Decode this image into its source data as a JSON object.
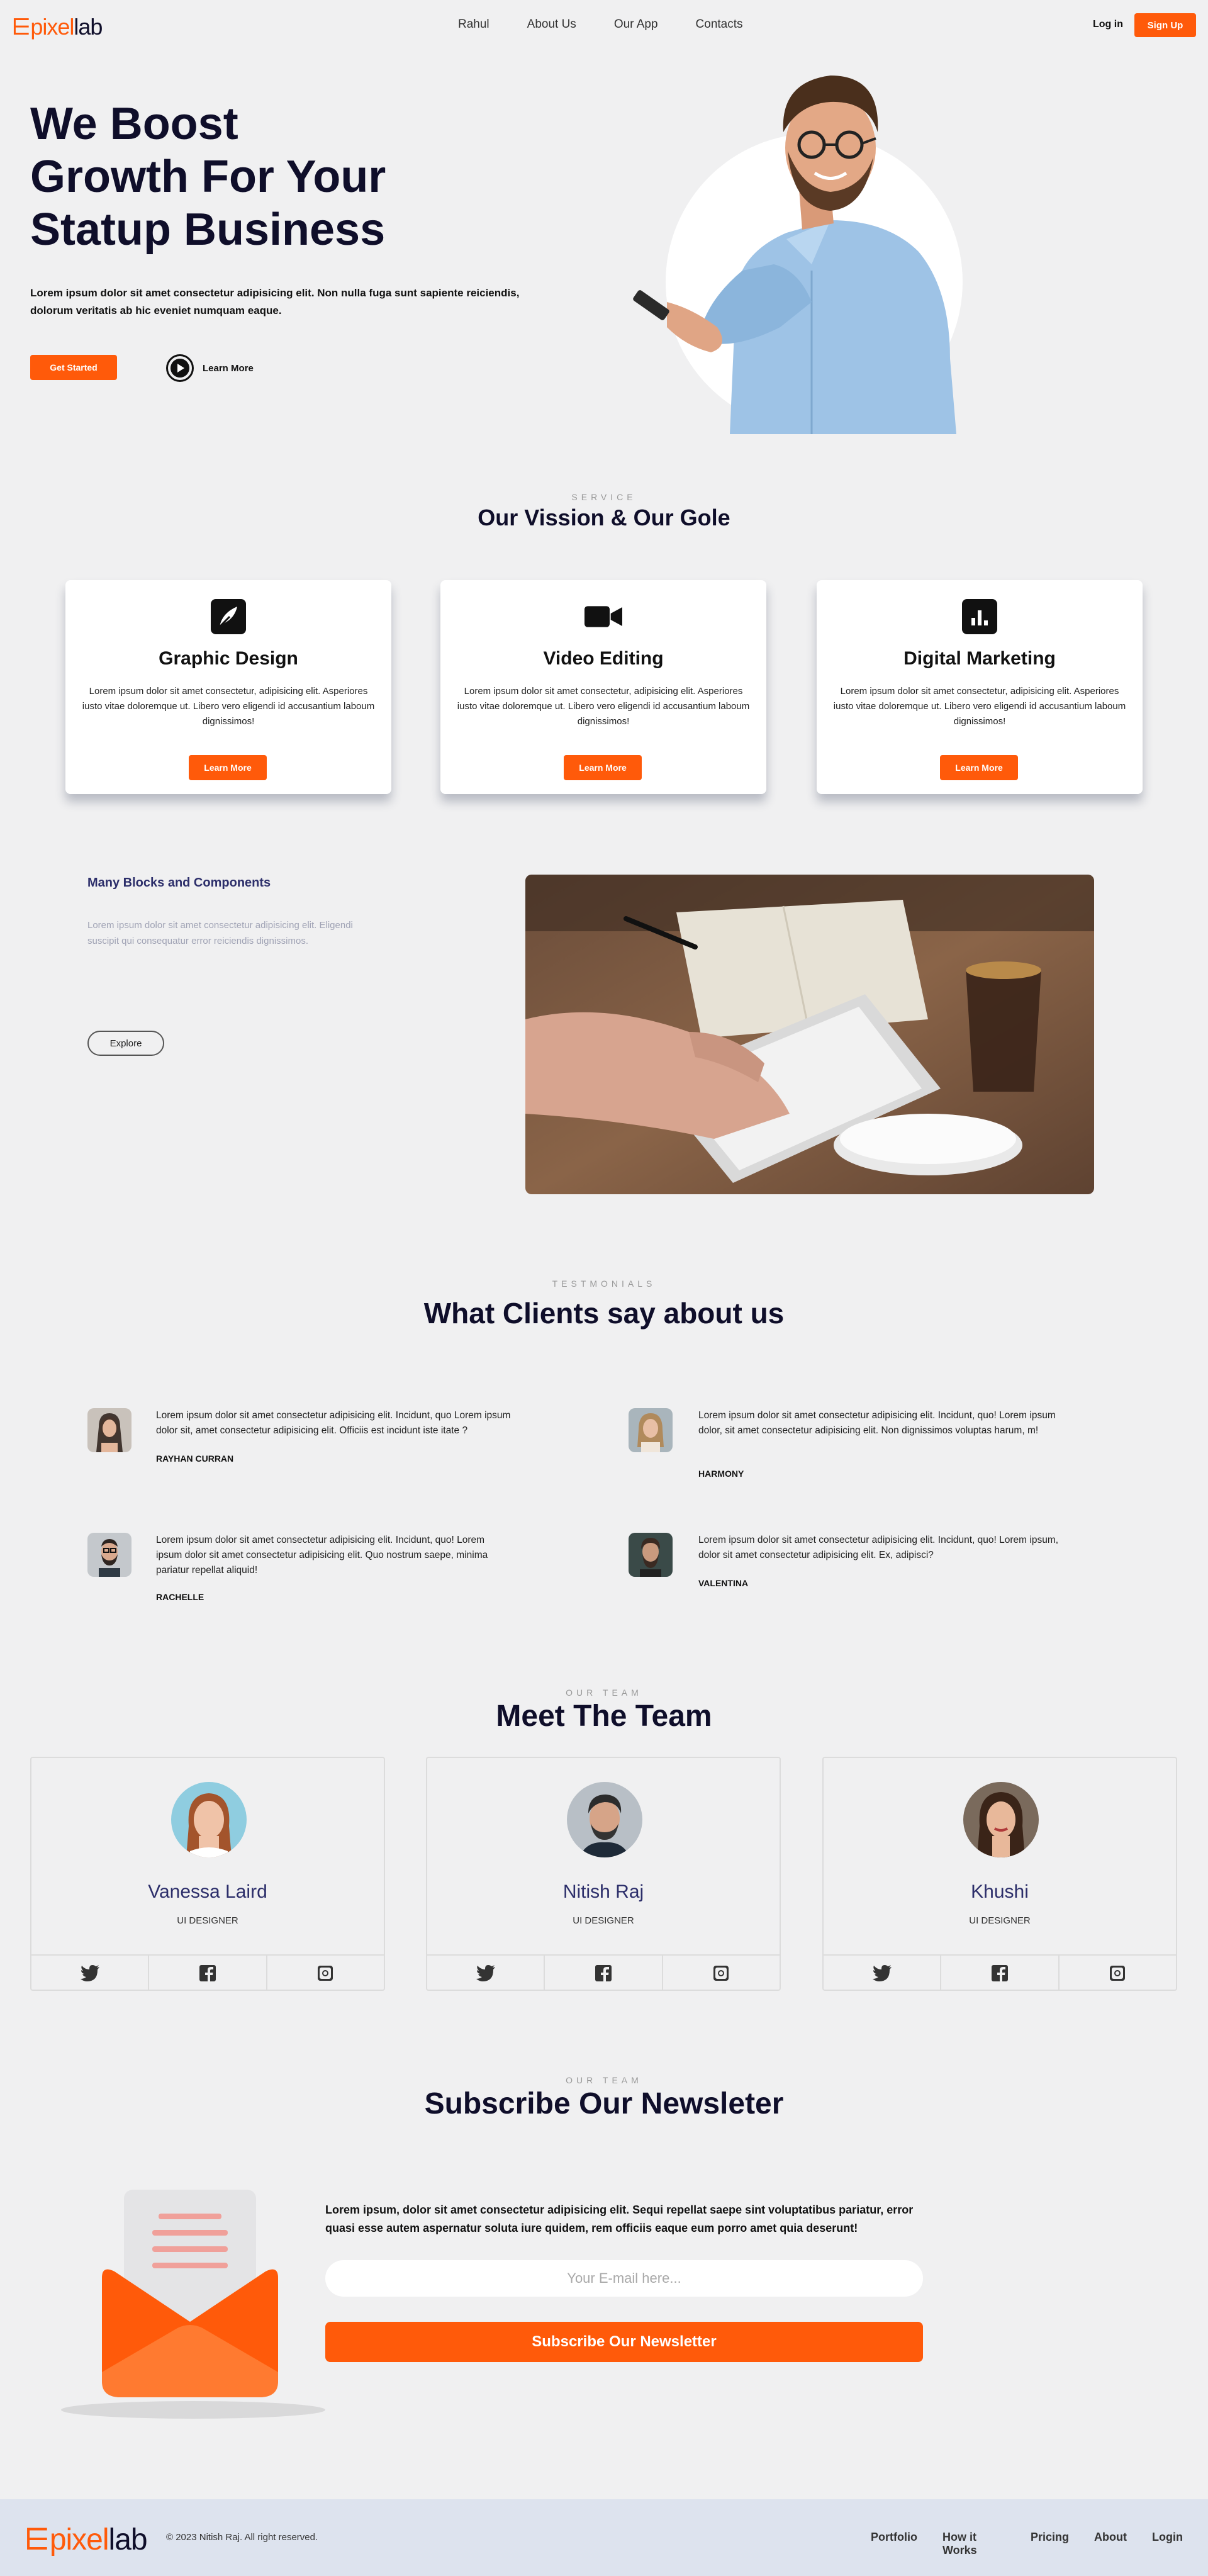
{
  "brand": {
    "logo_prefix": "⋿",
    "logo_pixel": "pixel",
    "logo_lab": "lab",
    "accent": "#ff5a0a",
    "navy": "#0f0e2a"
  },
  "nav": {
    "links": [
      "Rahul",
      "About Us",
      "Our App",
      "Contacts"
    ],
    "login": "Log in",
    "signup": "Sign Up"
  },
  "hero": {
    "title_lines": [
      "We Boost",
      "Growth For Your",
      "Statup Business"
    ],
    "description": "Lorem ipsum dolor sit amet consectetur adipisicing elit. Non nulla fuga sunt sapiente reiciendis, dolorum veritatis ab hic eveniet numquam eaque.",
    "cta_primary": "Get Started",
    "cta_secondary": "Learn More"
  },
  "service": {
    "kicker": "SERVICE",
    "title": "Our Vission & Our Gole",
    "cards": [
      {
        "icon": "feather-icon",
        "title": "Graphic Design",
        "text": "Lorem ipsum dolor sit amet consectetur, adipisicing elit. Asperiores iusto vitae doloremque ut. Libero vero eligendi id accusantium laboum dignissimos!",
        "button": "Learn More"
      },
      {
        "icon": "video-camera-icon",
        "title": "Video Editing",
        "text": "Lorem ipsum dolor sit amet consectetur, adipisicing elit. Asperiores iusto vitae doloremque ut. Libero vero eligendi id accusantium laboum dignissimos!",
        "button": "Learn More"
      },
      {
        "icon": "bar-chart-icon",
        "title": "Digital Marketing",
        "text": "Lorem ipsum dolor sit amet consectetur, adipisicing elit. Asperiores iusto vitae doloremque ut. Libero vero eligendi id accusantium laboum dignissimos!",
        "button": "Learn More"
      }
    ]
  },
  "blocks": {
    "title": "Many Blocks and Components",
    "text": "Lorem ipsum dolor sit amet consectetur adipisicing elit. Eligendi suscipit qui consequatur error reiciendis dignissimos.",
    "button": "Explore"
  },
  "testimonials": {
    "kicker": "TESTMONIALS",
    "title": "What Clients say about us",
    "items": [
      {
        "text": "Lorem ipsum dolor sit amet consectetur adipisicing elit. Incidunt, quo Lorem ipsum dolor sit, amet consectetur adipisicing elit. Officiis est incidunt iste itate ?",
        "name": "RAYHAN CURRAN"
      },
      {
        "text": "Lorem ipsum dolor sit amet consectetur adipisicing elit. Incidunt, quo! Lorem ipsum dolor, sit amet consectetur adipisicing elit. Non dignissimos voluptas harum, m!",
        "name": "HARMONY"
      },
      {
        "text": "Lorem ipsum dolor sit amet consectetur adipisicing elit. Incidunt, quo! Lorem ipsum dolor sit amet consectetur adipisicing elit. Quo nostrum saepe, minima pariatur repellat aliquid!",
        "name": "RACHELLE"
      },
      {
        "text": "Lorem ipsum dolor sit amet consectetur adipisicing elit. Incidunt, quo! Lorem ipsum, dolor sit amet consectetur adipisicing elit. Ex, adipisci?",
        "name": "VALENTINA"
      }
    ]
  },
  "team": {
    "kicker": "OUR TEAM",
    "title": "Meet The Team",
    "members": [
      {
        "name": "Vanessa Laird",
        "role": "UI DESIGNER"
      },
      {
        "name": "Nitish Raj",
        "role": "UI DESIGNER"
      },
      {
        "name": "Khushi",
        "role": "UI DESIGNER"
      }
    ]
  },
  "newsletter": {
    "kicker": "OUR TEAM",
    "title": "Subscribe Our Newsleter",
    "text": "Lorem ipsum, dolor sit amet consectetur adipisicing elit. Sequi repellat saepe sint voluptatibus pariatur, error quasi esse autem aspernatur soluta iure quidem, rem officiis eaque eum porro amet quia deserunt!",
    "placeholder": "Your E-mail here...",
    "button": "Subscribe Our Newsletter"
  },
  "footer": {
    "copyright": "© 2023 Nitish Raj. All right reserved.",
    "links": [
      "Portfolio",
      "How it Works",
      "Pricing",
      "About",
      "Login"
    ]
  }
}
